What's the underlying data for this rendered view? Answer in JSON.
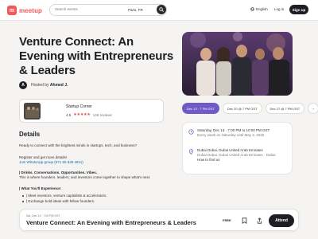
{
  "header": {
    "logo_letter": "m",
    "logo_text": "meetup",
    "search_placeholder": "Search events",
    "search_location": "Paris, FR",
    "language": "English",
    "login": "Log in",
    "signup": "Sign up"
  },
  "event": {
    "title_line1": "Venture Connect: An",
    "title_line2": "Evening with Entrepreneurs",
    "title_line3": "& Leaders",
    "host_initial": "A",
    "host_prefix": "Hosted by",
    "host_name": "Ahmed J."
  },
  "group": {
    "name": "Startup Corner",
    "rating": "4.5",
    "stars": "★★★★★",
    "reviews": "146 reviews"
  },
  "details": {
    "heading": "Details",
    "intro": "Ready to connect with the brightest minds in startups, tech, and business?",
    "register": "Register and get more details!",
    "join_text": "Join WhatsApp group (571 65 539 4811)",
    "drinks": "| Drinks. Conversations. Opportunities. Vibes.",
    "drinks_sub": "This is where founders, leaders, and investors come together to shape what's next.",
    "experience": "| What You'll Experience:",
    "bullets": [
      "| Meet investors, venture capitalists & accelerators.",
      "| Exchange bold ideas with fellow founders."
    ]
  },
  "dates": {
    "chips": [
      "Dec 13 · 7 PM GST",
      "Dec 20 @ 7 PM GST",
      "Dec 27 @ 7 PM GST"
    ],
    "arrow": "›"
  },
  "info": {
    "datetime": "Saturday, Dec 13 · 7:00 PM to 10:00 PM GST",
    "recurrence": "Every week on Saturday until May 4, 2026",
    "location_name": "Dubai Dubai, Dubai United Arab Emirates",
    "location_addr": "Dubai Dubai, Dubai United Arab Emirates · Dubai",
    "map_link": "How to find us"
  },
  "footer": {
    "date": "Sat, Dec 13 · 7:00 PM GST",
    "title": "Venture Connect: An Evening with Entrepreneurs & Leaders",
    "price": "FREE",
    "attend": "Attend"
  },
  "colors": {
    "brand": "#f65858",
    "accent": "#6f5bc7",
    "link": "#0e6ea6",
    "dark": "#1e1f24"
  }
}
